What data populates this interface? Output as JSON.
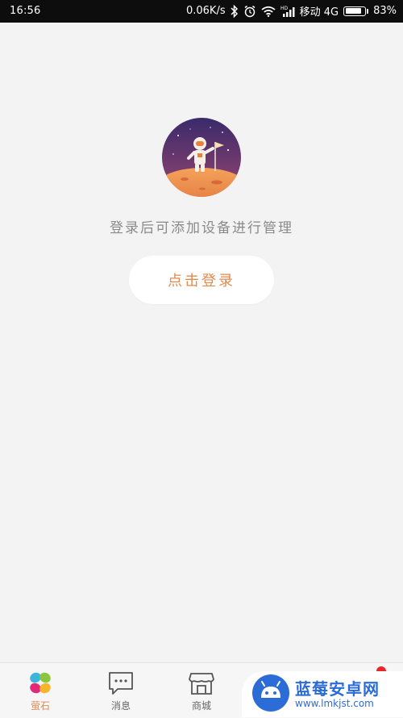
{
  "status_bar": {
    "time": "16:56",
    "network_speed": "0.06K/s",
    "carrier": "移动 4G",
    "battery_percent": "83%",
    "battery_level": 0.83,
    "icons": [
      "bluetooth-icon",
      "alarm-icon",
      "wifi-icon",
      "signal-hd-icon",
      "battery-icon"
    ]
  },
  "main": {
    "avatar_icon": "astronaut-planet-icon",
    "hint_text": "登录后可添加设备进行管理",
    "login_button_label": "点击登录",
    "accent_color": "#e08a4e"
  },
  "bottom_nav": {
    "items": [
      {
        "label": "萤石",
        "icon": "ezviz-logo-icon",
        "active": true
      },
      {
        "label": "消息",
        "icon": "message-bubble-icon",
        "active": false
      },
      {
        "label": "商城",
        "icon": "store-icon",
        "active": false
      }
    ]
  },
  "watermark": {
    "title": "蓝莓安卓网",
    "url": "www.lmkjst.com"
  }
}
